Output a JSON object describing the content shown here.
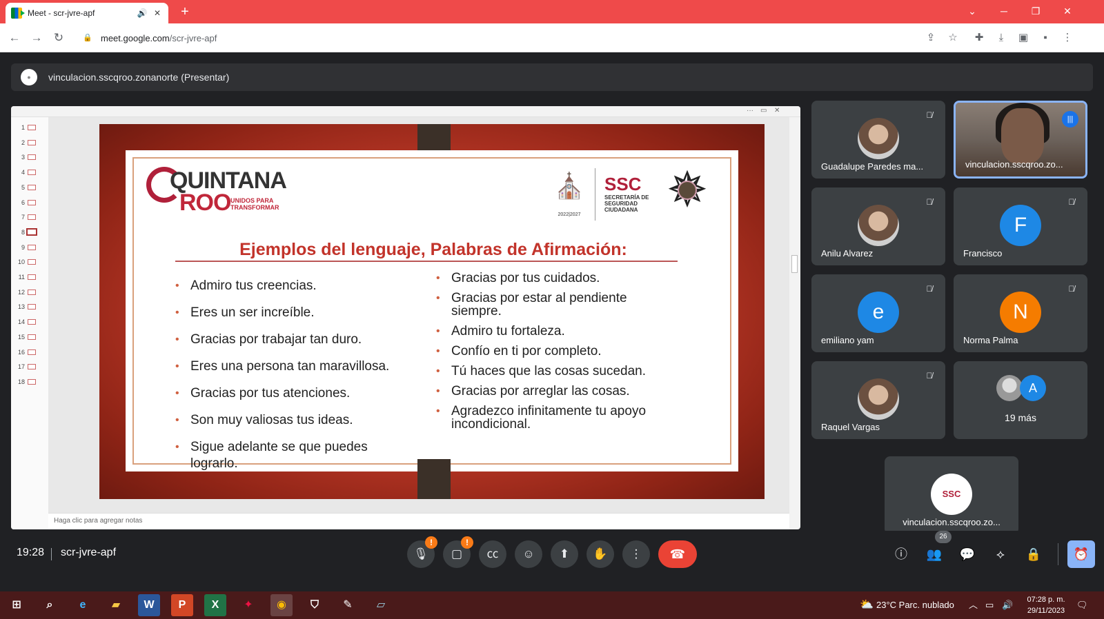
{
  "browser": {
    "tab_title": "Meet - scr-jvre-apf",
    "url_host": "meet.google.com",
    "url_path": "/scr-jvre-apf"
  },
  "presenter_bar": {
    "label": "vinculacion.sscqroo.zonanorte (Presentar)"
  },
  "slides_panel": {
    "numbers": [
      "1",
      "2",
      "3",
      "4",
      "5",
      "6",
      "7",
      "8",
      "9",
      "10",
      "11",
      "12",
      "13",
      "14",
      "15",
      "16",
      "17",
      "18"
    ],
    "selected": "8",
    "notes_placeholder": "Haga clic para agregar notas"
  },
  "slide": {
    "logo_text_a": "QUINTANA",
    "logo_text_b": "ROO",
    "logo_tagline": "UNIDOS PARA TRANSFORMAR",
    "crest_years": "2022|2027",
    "ssc": "SSC",
    "ssc_sub": "SECRETARÍA DE SEGURIDAD CIUDADANA",
    "title": "Ejemplos del lenguaje, Palabras de Afirmación:",
    "left_items": [
      "Admiro tus creencias.",
      "Eres un ser increíble.",
      "Gracias por trabajar tan duro.",
      "Eres una persona tan maravillosa.",
      "Gracias por tus atenciones.",
      "Son muy valiosas tus ideas.",
      "Sigue adelante se que puedes lograrlo."
    ],
    "right_items": [
      "Gracias por tus cuidados.",
      "Gracias por estar al  pendiente siempre.",
      "Admiro tu fortaleza.",
      "Confío en ti por completo.",
      "Tú haces que las cosas sucedan.",
      "Gracias por arreglar las cosas.",
      "Agradezco infinitamente tu apoyo incondicional."
    ]
  },
  "participants": [
    {
      "name": "Guadalupe Paredes ma...",
      "avatar": "",
      "muted": true
    },
    {
      "name": "vinculacion.sscqroo.zo...",
      "avatar": "",
      "speaking": true
    },
    {
      "name": "Anilu Alvarez",
      "avatar": "",
      "muted": true
    },
    {
      "name": "Francisco",
      "avatar": "F",
      "color": "#1e88e5",
      "muted": true
    },
    {
      "name": "emiliano yam",
      "avatar": "e",
      "color": "#1e88e5",
      "muted": true
    },
    {
      "name": "Norma Palma",
      "avatar": "N",
      "color": "#f57c00",
      "muted": true
    },
    {
      "name": "Raquel Vargas",
      "avatar": "",
      "muted": true
    },
    {
      "name": "",
      "avatar": "",
      "muted": false
    }
  ],
  "more_tile": {
    "label": "19 más",
    "avatar_letter": "A"
  },
  "self_tile": {
    "name": "vinculacion.sscqroo.zo..."
  },
  "bottom_bar": {
    "time": "19:28",
    "meeting_code": "scr-jvre-apf",
    "people_count": "26"
  },
  "taskbar": {
    "weather": "23°C  Parc. nublado",
    "time": "07:28 p. m.",
    "date": "29/11/2023"
  },
  "colors": {
    "accent_blue": "#8ab4f8",
    "end_call_red": "#ea4335",
    "slide_title_red": "#c2332a",
    "tab_bar_red": "#ef4a4a"
  }
}
